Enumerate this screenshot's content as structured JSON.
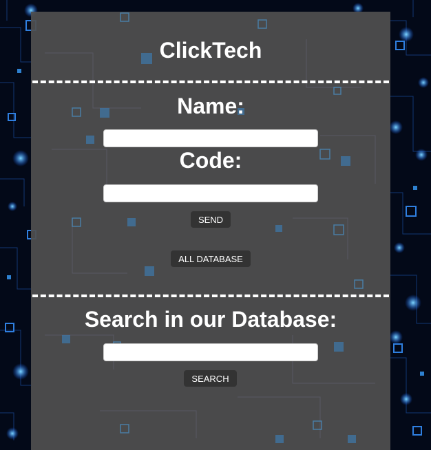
{
  "header": {
    "title": "ClickTech"
  },
  "form": {
    "name_label": "Name:",
    "name_value": "",
    "code_label": "Code:",
    "code_value": "",
    "send_label": "SEND",
    "all_database_label": "ALL DATABASE"
  },
  "search": {
    "heading": "Search in our Database:",
    "value": "",
    "button_label": "SEARCH"
  },
  "colors": {
    "panel": "#505050",
    "button": "#333333",
    "text": "#ffffff",
    "background_glow": "#2aa8ff"
  }
}
